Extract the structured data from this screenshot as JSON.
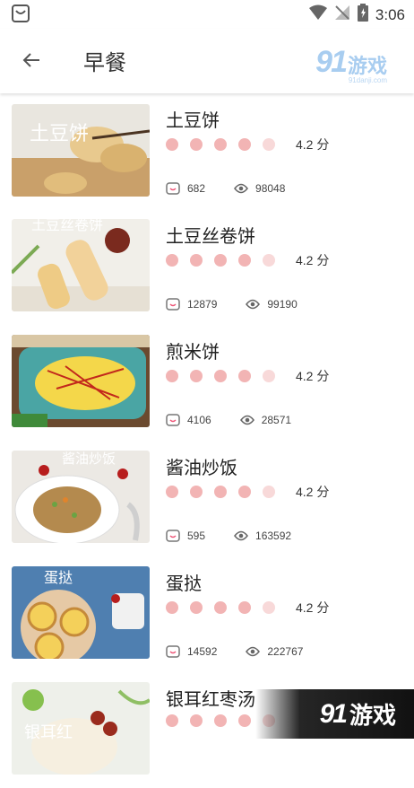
{
  "status_bar": {
    "time": "3:06",
    "icons": [
      "app-icon",
      "wifi-icon",
      "no-signal-icon",
      "battery-icon"
    ]
  },
  "toolbar": {
    "title": "早餐",
    "back_icon": "arrow-left-icon",
    "logo": {
      "num": "91",
      "text": "游戏",
      "sub": "91danji.com"
    }
  },
  "theme": {
    "dot_color": "#f2b4b4",
    "dot_faint_color": "#f8d9d9"
  },
  "recipes": [
    {
      "title": "土豆饼",
      "thumb_text": "土豆饼",
      "rating": 4.2,
      "rating_text": "4.2 分",
      "favorites": "682",
      "views": "98048"
    },
    {
      "title": "土豆丝卷饼",
      "thumb_text": "土豆丝卷饼",
      "rating": 4.2,
      "rating_text": "4.2 分",
      "favorites": "12879",
      "views": "99190"
    },
    {
      "title": "煎米饼",
      "thumb_text": "",
      "rating": 4.2,
      "rating_text": "4.2 分",
      "favorites": "4106",
      "views": "28571"
    },
    {
      "title": "酱油炒饭",
      "thumb_text": "酱油炒饭",
      "rating": 4.2,
      "rating_text": "4.2 分",
      "favorites": "595",
      "views": "163592"
    },
    {
      "title": "蛋挞",
      "thumb_text": "蛋挞",
      "rating": 4.2,
      "rating_text": "4.2 分",
      "favorites": "14592",
      "views": "222767"
    },
    {
      "title": "银耳红枣汤",
      "thumb_text": "银耳红",
      "rating": 4.2,
      "rating_text": "",
      "favorites": "",
      "views": ""
    }
  ],
  "watermark": {
    "num": "91",
    "text": "游戏"
  }
}
